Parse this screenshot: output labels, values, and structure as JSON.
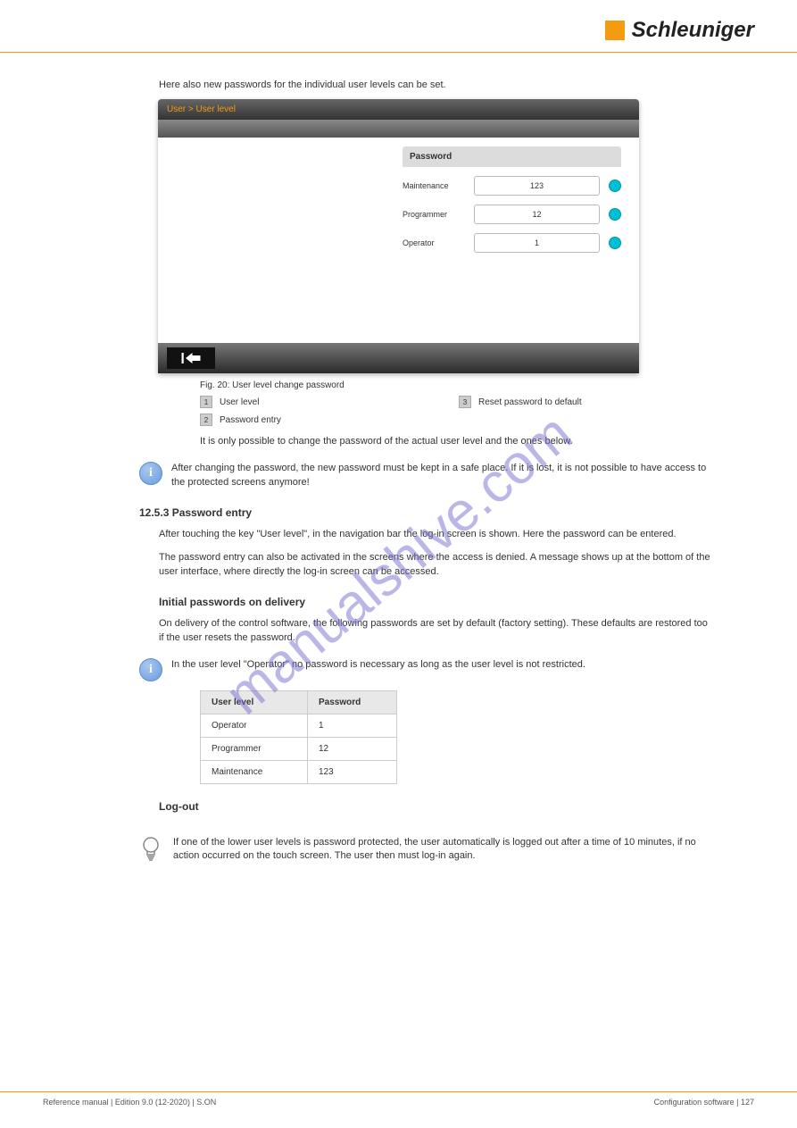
{
  "brand": {
    "name": "Schleuniger"
  },
  "intro": "Here also new passwords for the individual user levels can be set.",
  "hmi": {
    "breadcrumb": "User > User level",
    "section_header": "Password",
    "rows": [
      {
        "label": "Maintenance",
        "value": "123"
      },
      {
        "label": "Programmer",
        "value": "12"
      },
      {
        "label": "Operator",
        "value": "1"
      }
    ]
  },
  "figure_caption": "Fig. 20: User level change password",
  "key": {
    "items": [
      {
        "num": "1",
        "label": "User level"
      },
      {
        "num": "2",
        "label": "Password entry"
      },
      {
        "num": "3",
        "label": "Reset password to default"
      }
    ]
  },
  "notice1": "It is only possible to change the password of the actual user level and the ones below.",
  "info1": "After changing the password, the new password must be kept in a safe place. If it is lost, it is not possible to have access to the protected screens anymore!",
  "section_title": "12.5.3   Password entry",
  "para1": "After touching the key \"User level\", in the navigation bar the log-in screen is shown. Here the password can be entered.",
  "para2": "The password entry can also be activated in the screens where the access is denied. A message shows up at the bottom of the user interface, where directly the log-in screen can be accessed.",
  "section_title2": "Initial passwords on delivery",
  "para3": "On delivery of the control software, the following passwords are set by default (factory setting). These defaults are restored too if the user resets the password.",
  "info2": "In the user level \"Operator\" no password is necessary as long as the user level is not restricted.",
  "table": {
    "headers": [
      "User level",
      "Password"
    ],
    "rows": [
      {
        "level": "Operator",
        "pwd": "1"
      },
      {
        "level": "Programmer",
        "pwd": "12"
      },
      {
        "level": "Maintenance",
        "pwd": "123"
      }
    ]
  },
  "section_title3": "Log-out",
  "bulb_text": "If one of the lower user levels is password protected, the user automatically is logged out after a time of 10 minutes, if no action occurred on the touch screen. The user then must log-in again.",
  "footer": {
    "left": "Reference manual | Edition 9.0 (12-2020) | S.ON",
    "right": "Configuration software | 127"
  },
  "watermark": "manualshive.com"
}
